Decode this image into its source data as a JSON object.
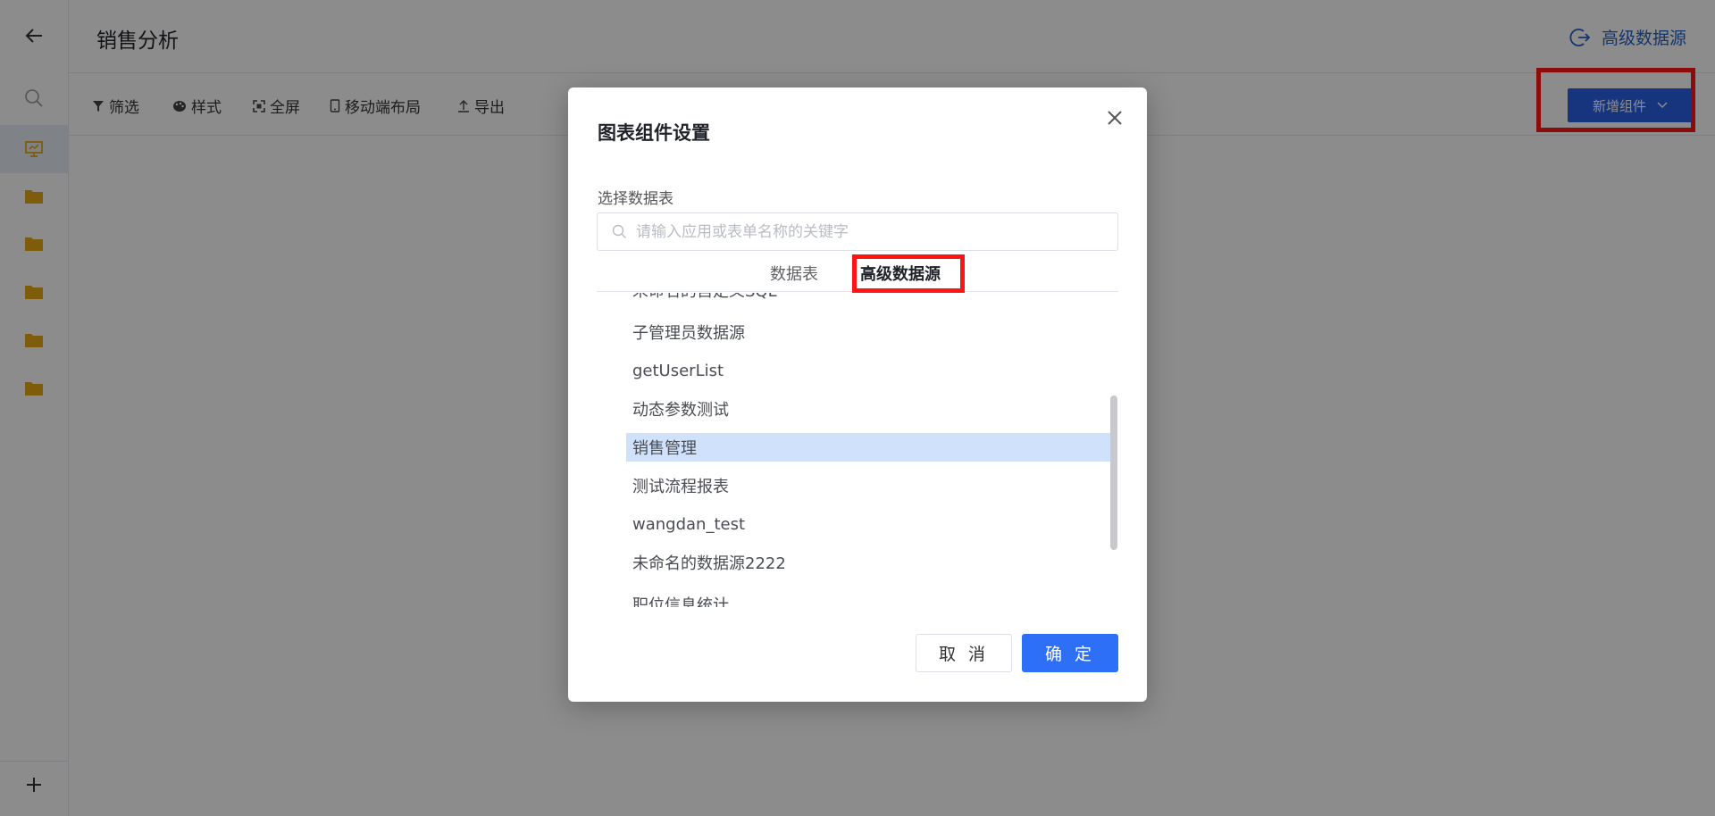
{
  "sidebar": {
    "icons": [
      "back-arrow-icon",
      "search-icon",
      "dashboard-screen-icon",
      "folder-icon",
      "plus-icon"
    ],
    "folder_count": 5
  },
  "header": {
    "title": "销售分析",
    "advanced_datasource_link": "高级数据源"
  },
  "toolbar": {
    "filter": "筛选",
    "style": "样式",
    "fullscreen": "全屏",
    "mobile_layout": "移动端布局",
    "export": "导出",
    "add_component": "新增组件"
  },
  "modal": {
    "title": "图表组件设置",
    "select_table_label": "选择数据表",
    "search_placeholder": "请输入应用或表单名称的关键字",
    "tabs": [
      {
        "label": "数据表",
        "active": false
      },
      {
        "label": "高级数据源",
        "active": true
      }
    ],
    "list": [
      {
        "label": "未命名的自定义SQL"
      },
      {
        "label": "子管理员数据源"
      },
      {
        "label": "getUserList"
      },
      {
        "label": "动态参数测试"
      },
      {
        "label": "销售管理",
        "selected": true
      },
      {
        "label": "测试流程报表"
      },
      {
        "label": "wangdan_test"
      },
      {
        "label": "未命名的数据源2222"
      },
      {
        "label": "职位信息统计"
      }
    ],
    "cancel": "取 消",
    "confirm": "确 定"
  },
  "colors": {
    "accent": "#2a60e5",
    "confirm": "#2d6ff7",
    "selected_row": "#cfe1fb",
    "highlight": "#ff1414",
    "folder": "#e6a817"
  }
}
